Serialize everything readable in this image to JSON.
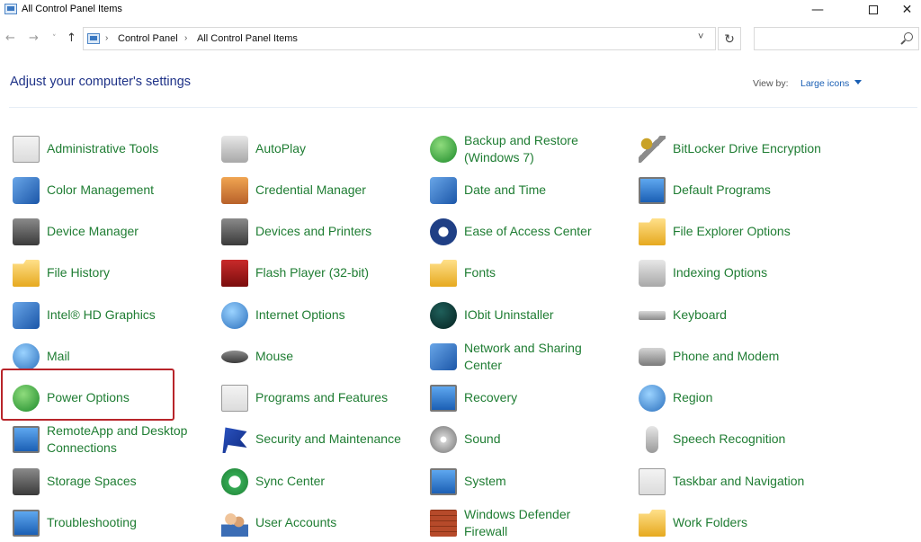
{
  "window": {
    "title": "All Control Panel Items",
    "minimize": "—",
    "close": "✕"
  },
  "nav": {
    "back": "←",
    "forward": "→",
    "recent": "˅",
    "up": "↑",
    "breadcrumb": [
      "Control Panel",
      "All Control Panel Items"
    ],
    "breadcrumb_sep": "›",
    "dropdown": "˅",
    "refresh": "↻",
    "search_placeholder": ""
  },
  "header": {
    "title": "Adjust your computer's settings",
    "view_by_label": "View by:",
    "view_by_value": "Large icons"
  },
  "items": [
    {
      "label": "Administrative Tools",
      "icon": "administrative-tools-icon"
    },
    {
      "label": "AutoPlay",
      "icon": "autoplay-icon"
    },
    {
      "label": "Backup and Restore\n(Windows 7)",
      "icon": "backup-restore-icon"
    },
    {
      "label": "BitLocker Drive Encryption",
      "icon": "bitlocker-icon"
    },
    {
      "label": "Color Management",
      "icon": "color-management-icon"
    },
    {
      "label": "Credential Manager",
      "icon": "credential-manager-icon"
    },
    {
      "label": "Date and Time",
      "icon": "date-time-icon"
    },
    {
      "label": "Default Programs",
      "icon": "default-programs-icon"
    },
    {
      "label": "Device Manager",
      "icon": "device-manager-icon"
    },
    {
      "label": "Devices and Printers",
      "icon": "devices-printers-icon"
    },
    {
      "label": "Ease of Access Center",
      "icon": "ease-of-access-icon"
    },
    {
      "label": "File Explorer Options",
      "icon": "file-explorer-options-icon"
    },
    {
      "label": "File History",
      "icon": "file-history-icon"
    },
    {
      "label": "Flash Player (32-bit)",
      "icon": "flash-player-icon"
    },
    {
      "label": "Fonts",
      "icon": "fonts-icon"
    },
    {
      "label": "Indexing Options",
      "icon": "indexing-options-icon"
    },
    {
      "label": "Intel® HD Graphics",
      "icon": "intel-graphics-icon"
    },
    {
      "label": "Internet Options",
      "icon": "internet-options-icon"
    },
    {
      "label": "IObit Uninstaller",
      "icon": "iobit-uninstaller-icon"
    },
    {
      "label": "Keyboard",
      "icon": "keyboard-icon"
    },
    {
      "label": "Mail",
      "icon": "mail-icon"
    },
    {
      "label": "Mouse",
      "icon": "mouse-icon"
    },
    {
      "label": "Network and Sharing\nCenter",
      "icon": "network-sharing-icon"
    },
    {
      "label": "Phone and Modem",
      "icon": "phone-modem-icon"
    },
    {
      "label": "Power Options",
      "icon": "power-options-icon"
    },
    {
      "label": "Programs and Features",
      "icon": "programs-features-icon"
    },
    {
      "label": "Recovery",
      "icon": "recovery-icon"
    },
    {
      "label": "Region",
      "icon": "region-icon"
    },
    {
      "label": "RemoteApp and Desktop\nConnections",
      "icon": "remoteapp-icon"
    },
    {
      "label": "Security and Maintenance",
      "icon": "security-maintenance-icon"
    },
    {
      "label": "Sound",
      "icon": "sound-icon"
    },
    {
      "label": "Speech Recognition",
      "icon": "speech-recognition-icon"
    },
    {
      "label": "Storage Spaces",
      "icon": "storage-spaces-icon"
    },
    {
      "label": "Sync Center",
      "icon": "sync-center-icon"
    },
    {
      "label": "System",
      "icon": "system-icon"
    },
    {
      "label": "Taskbar and Navigation",
      "icon": "taskbar-navigation-icon"
    },
    {
      "label": "Troubleshooting",
      "icon": "troubleshooting-icon"
    },
    {
      "label": "User Accounts",
      "icon": "user-accounts-icon"
    },
    {
      "label": "Windows Defender\nFirewall",
      "icon": "windows-firewall-icon"
    },
    {
      "label": "Work Folders",
      "icon": "work-folders-icon"
    }
  ],
  "highlighted_item": "Power Options",
  "colors": {
    "item_label": "#1f7d33",
    "heading": "#1e3287",
    "link": "#1a5fb4",
    "highlight": "#b8242a"
  }
}
